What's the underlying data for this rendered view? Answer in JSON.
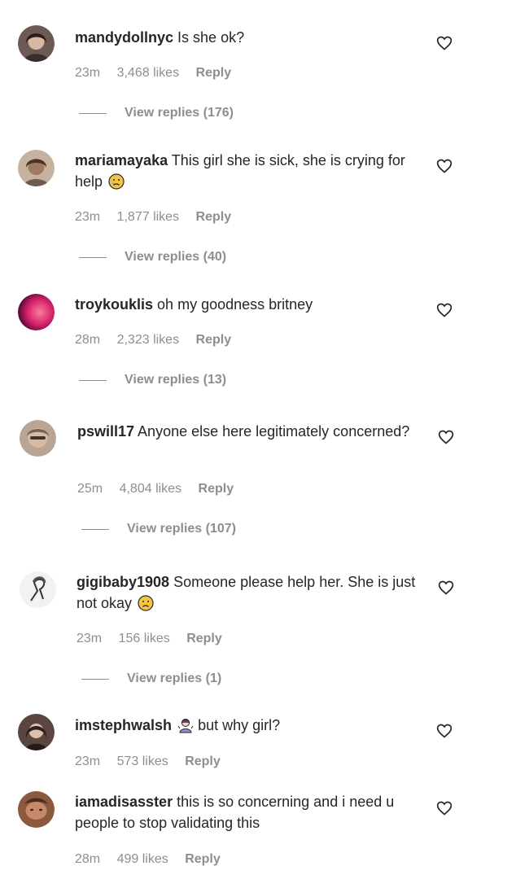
{
  "comments": [
    {
      "username": "mandydollnyc",
      "text": "Is she ok?",
      "time": "23m",
      "likes": "3,468 likes",
      "reply": "Reply",
      "view_replies": "View replies (176)",
      "avatar_color": "#6b5a55"
    },
    {
      "username": "mariamayaka",
      "text": "This girl she is sick, she is crying for help",
      "time": "23m",
      "likes": "1,877 likes",
      "reply": "Reply",
      "view_replies": "View replies (40)",
      "avatar_color": "#a08774",
      "emoji": "crying-face-emoji"
    },
    {
      "username": "troykouklis",
      "text": "oh my goodness britney",
      "time": "28m",
      "likes": "2,323 likes",
      "reply": "Reply",
      "view_replies": "View replies (13)",
      "avatar_color": "#d0206a"
    },
    {
      "username": "pswill17",
      "text": "Anyone else here legitimately concerned?",
      "time": "25m",
      "likes": "4,804 likes",
      "reply": "Reply",
      "view_replies": "View replies (107)",
      "avatar_color": "#a8927f"
    },
    {
      "username": "gigibaby1908",
      "text": "Someone please help her. She is just not okay",
      "time": "23m",
      "likes": "156 likes",
      "reply": "Reply",
      "view_replies": "View replies (1)",
      "avatar_color": "#dddddd",
      "emoji": "sad-face-emoji"
    },
    {
      "username": "imstephwalsh",
      "text": "but why girl?",
      "time": "23m",
      "likes": "573 likes",
      "reply": "Reply",
      "avatar_color": "#5a4540",
      "emoji": "person-shrugging-emoji"
    },
    {
      "username": "iamadisasster",
      "text": "this is so concerning and i need u people to stop validating this",
      "time": "28m",
      "likes": "499 likes",
      "reply": "Reply",
      "avatar_color": "#8a5a40"
    }
  ],
  "colors": {
    "text": "#262626",
    "secondary": "#8e8e8e",
    "background": "#ffffff"
  },
  "icons": {
    "like": "heart-outline-icon"
  }
}
